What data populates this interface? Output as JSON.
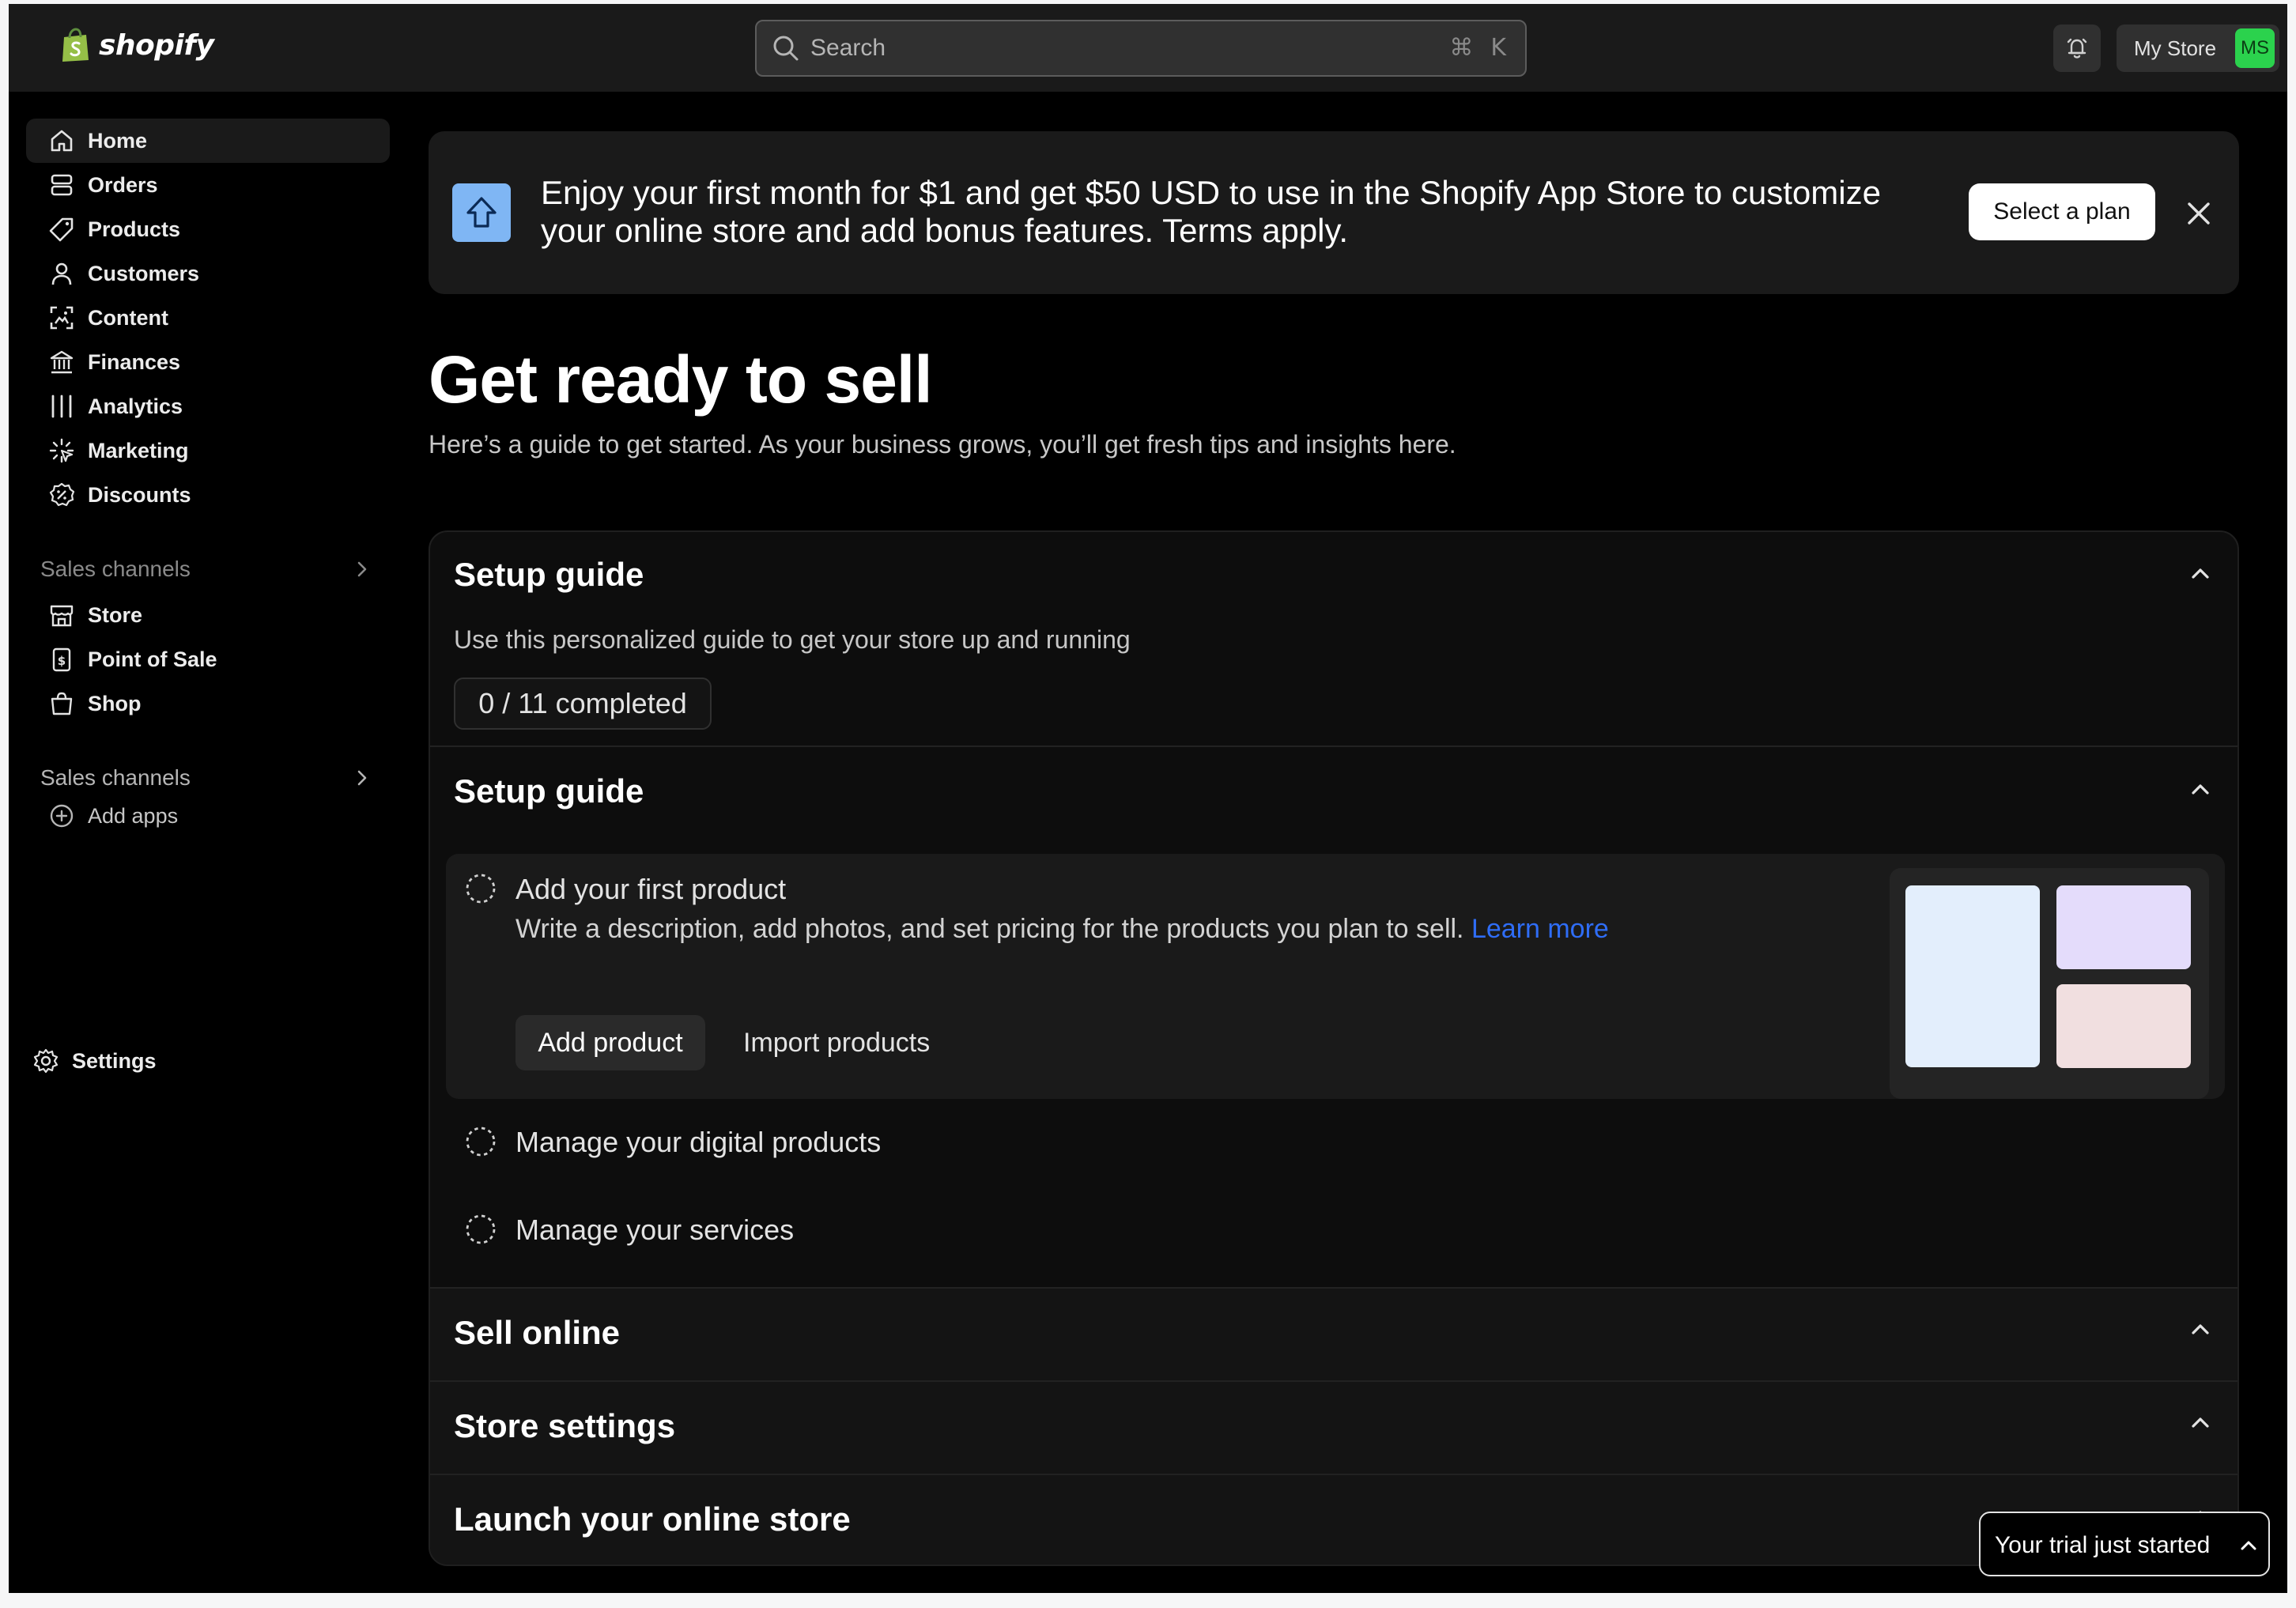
{
  "app": {
    "brand": "shopify"
  },
  "search": {
    "placeholder": "Search",
    "shortcut_symbol": "⌘",
    "shortcut_key": "K"
  },
  "account": {
    "store_name": "My Store",
    "avatar_initials": "MS",
    "avatar_color": "#2bd24d"
  },
  "sidebar": {
    "items": [
      {
        "label": "Home",
        "icon": "home-icon",
        "active": true
      },
      {
        "label": "Orders",
        "icon": "orders-icon"
      },
      {
        "label": "Products",
        "icon": "tag-icon"
      },
      {
        "label": "Customers",
        "icon": "person-icon"
      },
      {
        "label": "Content",
        "icon": "content-icon"
      },
      {
        "label": "Finances",
        "icon": "bank-icon"
      },
      {
        "label": "Analytics",
        "icon": "bar-chart-icon"
      },
      {
        "label": "Marketing",
        "icon": "target-icon"
      },
      {
        "label": "Discounts",
        "icon": "discount-icon"
      }
    ],
    "sales_channels_label": "Sales channels",
    "sales_channels": [
      {
        "label": "Store",
        "icon": "storefront-icon"
      },
      {
        "label": "Point of Sale",
        "icon": "pos-icon"
      },
      {
        "label": "Shop",
        "icon": "shopping-bag-icon"
      }
    ],
    "apps_section_label": "Sales channels",
    "add_apps_label": "Add apps",
    "settings_label": "Settings"
  },
  "banner": {
    "message": "Enjoy your first month for $1 and get $50 USD to use in the Shopify App Store to customize your online store and add bonus features. Terms apply.",
    "button_label": "Select a plan",
    "icon_color": "#7fb6f4"
  },
  "page": {
    "title": "Get ready to sell",
    "subtitle": "Here’s a guide to get started. As your business grows, you’ll get fresh tips and insights here."
  },
  "setup": {
    "header": "Setup guide",
    "description": "Use this personalized guide to get your store up and running",
    "progress": "0 / 11 completed",
    "subsection_header": "Setup guide",
    "active_task": {
      "title": "Add your first product",
      "description": "Write a description, add photos, and set pricing for the products you plan to sell.",
      "link": "Learn more",
      "primary_button": "Add product",
      "secondary_button": "Import products"
    },
    "tasks": [
      "Manage your digital products",
      "Manage your services"
    ],
    "sections": [
      "Sell online",
      "Store settings",
      "Launch your online store"
    ]
  },
  "trial": {
    "label": "Your trial just started"
  }
}
